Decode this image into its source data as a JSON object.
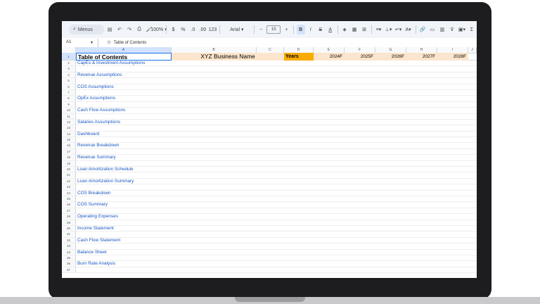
{
  "toolbar": {
    "menus_label": "Menus",
    "zoom": "100%",
    "currency": "$",
    "percent": "%",
    "decimal_decrease": ".0",
    "decimal_increase": ".00",
    "number_format": "123",
    "font": "Arial",
    "font_size": "15"
  },
  "formula_bar": {
    "cell_ref": "A1",
    "fx": "fx",
    "content": "Table of Contents"
  },
  "columns": [
    "A",
    "B",
    "C",
    "D",
    "E",
    "F",
    "G",
    "H",
    "I",
    "J"
  ],
  "header_row": {
    "number": "1",
    "a": "Table of Contents",
    "b": "XYZ Business Name",
    "d": "Years",
    "e": "2024F",
    "f": "2025F",
    "g": "2026F",
    "h": "2027F",
    "i": "2028F"
  },
  "rows": [
    {
      "n": "2",
      "a": "CapEx & Investment Assumptions"
    },
    {
      "n": "3",
      "a": ""
    },
    {
      "n": "4",
      "a": "Revenue Assumptions"
    },
    {
      "n": "5",
      "a": ""
    },
    {
      "n": "6",
      "a": "COS Assumptions"
    },
    {
      "n": "7",
      "a": ""
    },
    {
      "n": "8",
      "a": "OpEx Assumptions"
    },
    {
      "n": "9",
      "a": ""
    },
    {
      "n": "10",
      "a": "Cash Flow Assumptions"
    },
    {
      "n": "11",
      "a": ""
    },
    {
      "n": "12",
      "a": "Salaries Assumptions"
    },
    {
      "n": "13",
      "a": ""
    },
    {
      "n": "14",
      "a": "Dashboard"
    },
    {
      "n": "15",
      "a": ""
    },
    {
      "n": "16",
      "a": "Revenue Breakdown"
    },
    {
      "n": "17",
      "a": ""
    },
    {
      "n": "18",
      "a": "Revenue Summary"
    },
    {
      "n": "19",
      "a": ""
    },
    {
      "n": "20",
      "a": "Loan Amortization Schedule"
    },
    {
      "n": "21",
      "a": ""
    },
    {
      "n": "22",
      "a": "Loan Amortization Summary"
    },
    {
      "n": "23",
      "a": ""
    },
    {
      "n": "24",
      "a": "COS Breakdown"
    },
    {
      "n": "25",
      "a": ""
    },
    {
      "n": "26",
      "a": "COS Summary"
    },
    {
      "n": "27",
      "a": ""
    },
    {
      "n": "28",
      "a": "Operating Expenses"
    },
    {
      "n": "29",
      "a": ""
    },
    {
      "n": "30",
      "a": "Income Statement"
    },
    {
      "n": "31",
      "a": ""
    },
    {
      "n": "32",
      "a": "Cash Flow Statement"
    },
    {
      "n": "33",
      "a": ""
    },
    {
      "n": "34",
      "a": "Balance Sheet"
    },
    {
      "n": "35",
      "a": ""
    },
    {
      "n": "36",
      "a": "Burn Rate Analysis"
    },
    {
      "n": "37",
      "a": ""
    }
  ]
}
